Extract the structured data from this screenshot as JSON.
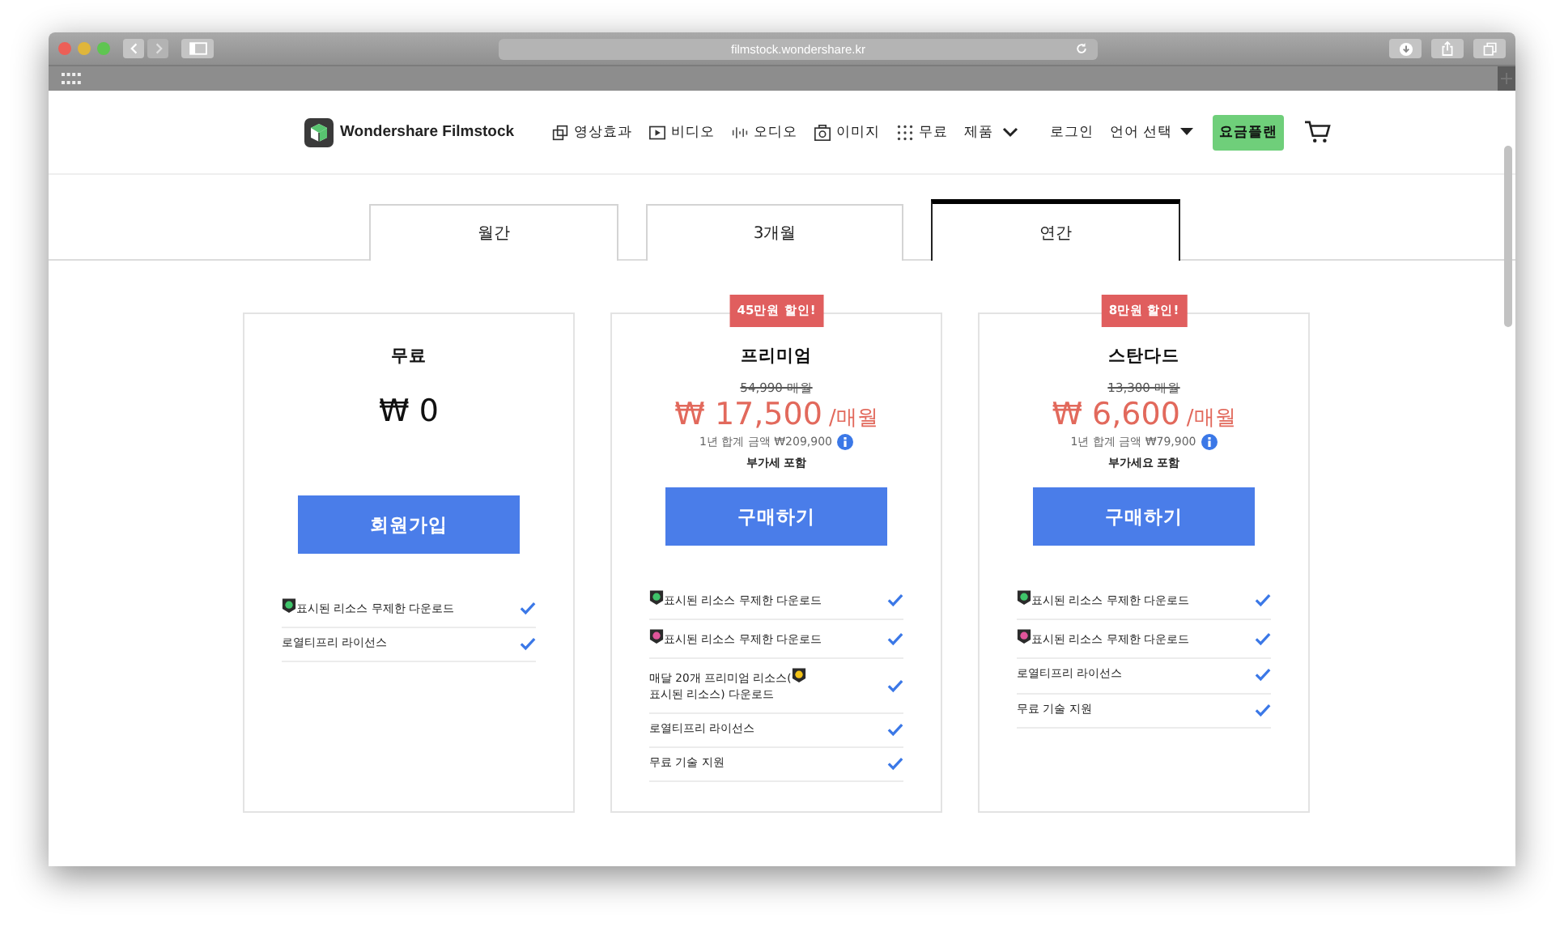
{
  "browser": {
    "url": "filmstock.wondershare.kr"
  },
  "nav": {
    "logo": "Wondershare Filmstock",
    "items": [
      {
        "kind": "effects",
        "label": "영상효과"
      },
      {
        "kind": "video",
        "label": "비디오"
      },
      {
        "kind": "audio",
        "label": "오디오"
      },
      {
        "kind": "image",
        "label": "이미지"
      },
      {
        "kind": "free",
        "label": "무료"
      },
      {
        "kind": "menu",
        "label": "제품"
      }
    ],
    "login": "로그인",
    "language": "언어 선택",
    "pricing": "요금플랜"
  },
  "tabs": [
    {
      "label": "월간",
      "selected": false
    },
    {
      "label": "3개월",
      "selected": false
    },
    {
      "label": "연간",
      "selected": true
    }
  ],
  "plans": [
    {
      "name": "무료",
      "price": "₩ 0",
      "button": "회원가입",
      "features": [
        {
          "color": "#3fc46a",
          "text": "표시된 리소스 무제한 다운로드"
        },
        {
          "text": "로열티프리 라이선스"
        }
      ]
    },
    {
      "badge": "45만원 할인!",
      "name": "프리미엄",
      "old_price": "54,990 매월",
      "price": "₩ 17,500",
      "per": "/매월",
      "total": "1년 합계 금액 ₩209,900",
      "vat": "부가세 포함",
      "button": "구매하기",
      "features": [
        {
          "color": "#3fc46a",
          "text": "표시된 리소스 무제한 다운로드"
        },
        {
          "color": "#e0559a",
          "text": "표시된 리소스 무제한 다운로드"
        },
        {
          "before": "매달 20개 프리미엄 리소스(",
          "color": "#f3c316",
          "text": "표시된 리소스) 다운로드"
        },
        {
          "text": "로열티프리 라이선스"
        },
        {
          "text": "무료 기술 지원"
        }
      ]
    },
    {
      "badge": "8만원 할인!",
      "name": "스탄다드",
      "old_price": "13,300 매월",
      "price": "₩ 6,600",
      "per": "/매월",
      "total": "1년 합계 금액 ₩79,900",
      "vat": "부가세요 포함",
      "button": "구매하기",
      "features": [
        {
          "color": "#3fc46a",
          "text": "표시된 리소스 무제한 다운로드"
        },
        {
          "color": "#e0559a",
          "text": "표시된 리소스 무제한 다운로드"
        },
        {
          "text": "로열티프리 라이선스"
        },
        {
          "text": "무료 기술 지원"
        }
      ]
    }
  ]
}
